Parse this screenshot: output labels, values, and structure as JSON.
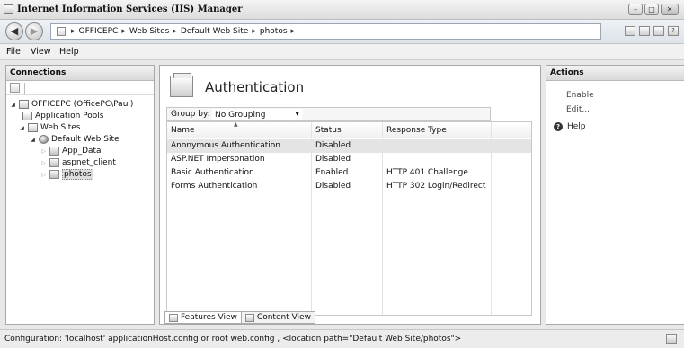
{
  "window": {
    "title": "Internet Information Services (IIS) Manager",
    "controls": {
      "minimize": "–",
      "maximize": "□",
      "close": "✕"
    }
  },
  "address": {
    "crumbs": [
      "OFFICEPC",
      "Web Sites",
      "Default Web Site",
      "photos"
    ],
    "separator": "▸",
    "help_glyph": "?"
  },
  "menu": [
    "File",
    "View",
    "Help"
  ],
  "connections": {
    "header": "Connections",
    "tree": [
      {
        "label": "OFFICEPC (OfficePC\\Paul)",
        "icon": "server-icon"
      },
      {
        "label": "Application Pools",
        "icon": "app-pools-icon"
      },
      {
        "label": "Web Sites",
        "icon": "sites-icon"
      },
      {
        "label": "Default Web Site",
        "icon": "globe-icon"
      },
      {
        "label": "App_Data",
        "icon": "folder-icon"
      },
      {
        "label": "aspnet_client",
        "icon": "folder-icon"
      },
      {
        "label": "photos",
        "icon": "folder-icon",
        "selected": true
      }
    ]
  },
  "feature": {
    "title": "Authentication",
    "group_by_label": "Group by:",
    "group_by_value": "No Grouping",
    "columns": [
      "Name",
      "Status",
      "Response Type"
    ],
    "rows": [
      {
        "name": "Anonymous Authentication",
        "status": "Disabled",
        "response": "",
        "selected": true
      },
      {
        "name": "ASP.NET Impersonation",
        "status": "Disabled",
        "response": ""
      },
      {
        "name": "Basic Authentication",
        "status": "Enabled",
        "response": "HTTP 401 Challenge"
      },
      {
        "name": "Forms Authentication",
        "status": "Disabled",
        "response": "HTTP 302 Login/Redirect"
      }
    ],
    "tabs": [
      "Features View",
      "Content View"
    ]
  },
  "actions": {
    "header": "Actions",
    "items": [
      "Enable",
      "Edit..."
    ],
    "help": "Help"
  },
  "status": {
    "text": "Configuration: 'localhost' applicationHost.config or root web.config , <location path=\"Default Web Site/photos\">"
  }
}
